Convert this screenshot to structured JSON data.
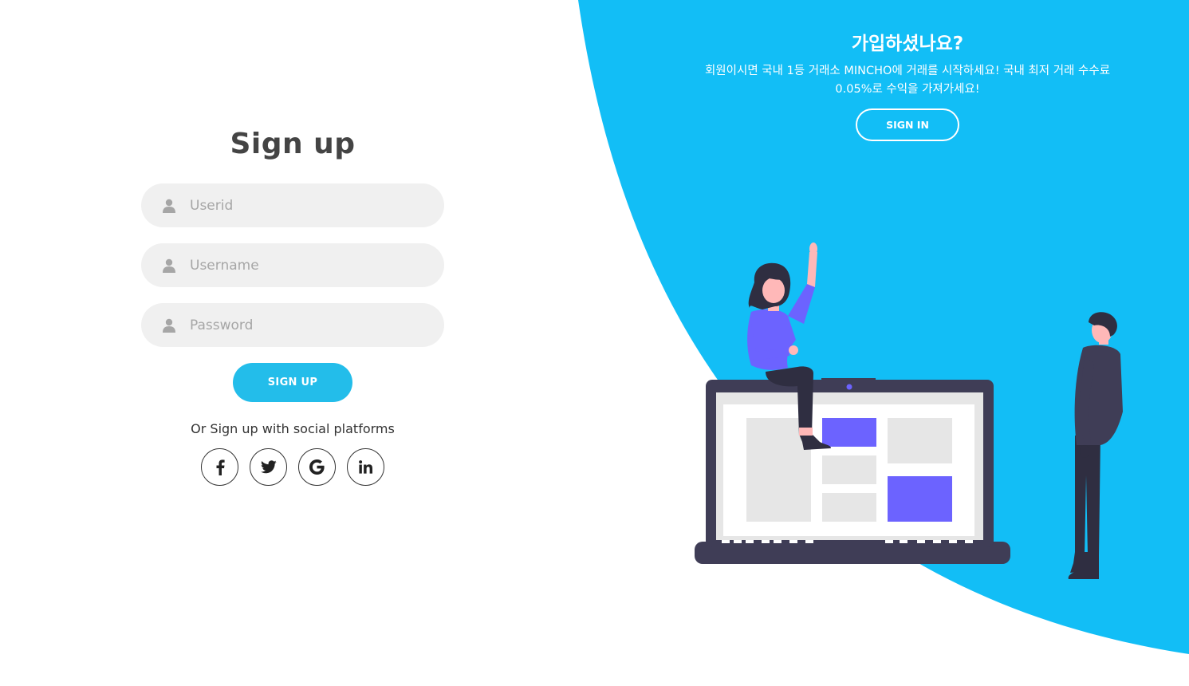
{
  "form": {
    "title": "Sign up",
    "fields": [
      {
        "placeholder": "Userid",
        "icon": "user-icon"
      },
      {
        "placeholder": "Username",
        "icon": "user-icon"
      },
      {
        "placeholder": "Password",
        "icon": "user-icon"
      }
    ],
    "submit_label": "SIGN UP",
    "social_text": "Or Sign up with social platforms",
    "social": [
      {
        "icon": "facebook-icon",
        "label": "f"
      },
      {
        "icon": "twitter-icon"
      },
      {
        "icon": "google-icon",
        "label": "G"
      },
      {
        "icon": "linkedin-icon",
        "label": "in"
      }
    ]
  },
  "panel": {
    "title": "가입하셨나요?",
    "description": "회원이시면 국내 1등 거래소 MINCHO에 거래를 시작하세요! 국내 최저 거래 수수료 0.05%로 수익을 가져가세요!",
    "signin_label": "SIGN IN"
  },
  "colors": {
    "accent": "#12bef6",
    "button": "#23bdea",
    "field_bg": "#f0f0f0",
    "purple": "#6c63ff",
    "dark": "#3f3d56"
  }
}
